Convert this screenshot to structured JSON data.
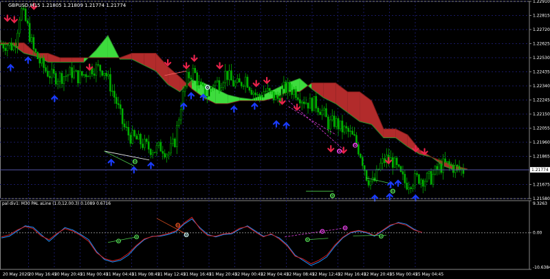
{
  "window": {
    "main_title": "GBPUSD,M15  1.21805 1.21809 1.21774 1.21774",
    "indicator_title": "pal div1: M30 PAL aLine (1.0,12.00.3) 0.1089 0.6716"
  },
  "chart_data": [
    {
      "type": "candlestick",
      "symbol": "GBPUSD",
      "timeframe": "M15",
      "ohlc_header": {
        "open": 1.21805,
        "high": 1.21809,
        "low": 1.21774,
        "close": 1.21774
      },
      "ylim": [
        1.2158,
        1.2291
      ],
      "y_ticks": [
        "1.22910",
        "1.22815",
        "1.22720",
        "1.22625",
        "1.22530",
        "1.22435",
        "1.22340",
        "1.22245",
        "1.22150",
        "1.22055",
        "1.21960",
        "1.21865",
        "1.21675",
        "1.21580"
      ],
      "current_price_label": "1.21774",
      "current_price": 1.21774,
      "close_path": [
        1.2262,
        1.2262,
        1.226,
        1.2286,
        1.2275,
        1.2258,
        1.225,
        1.2244,
        1.224,
        1.224,
        1.2241,
        1.2243,
        1.224,
        1.2242,
        1.2246,
        1.2246,
        1.2245,
        1.2234,
        1.2222,
        1.2207,
        1.22,
        1.2198,
        1.2195,
        1.2192,
        1.2191,
        1.2193,
        1.2188,
        1.2196,
        1.2222,
        1.224,
        1.2244,
        1.2232,
        1.2228,
        1.2236,
        1.2236,
        1.2243,
        1.2236,
        1.2234,
        1.224,
        1.2232,
        1.2226,
        1.2231,
        1.2228,
        1.2225,
        1.2232,
        1.2232,
        1.223,
        1.2225,
        1.2222,
        1.2222,
        1.2217,
        1.2208,
        1.221,
        1.2205,
        1.2203,
        1.2198,
        1.2188,
        1.2172,
        1.2168,
        1.218,
        1.2185,
        1.2183,
        1.2175,
        1.2168,
        1.217,
        1.2172,
        1.2171,
        1.2172,
        1.2178,
        1.2181,
        1.218,
        1.2178,
        1.2177
      ],
      "cloud": {
        "span_a": [
          1.2262,
          1.2262,
          1.2256,
          1.2254,
          1.225,
          1.225,
          1.225,
          1.225,
          1.2258,
          1.2268,
          1.2252,
          1.2252,
          1.2248,
          1.2244,
          1.2235,
          1.223,
          1.2238,
          1.2236,
          1.2232,
          1.2228,
          1.2226,
          1.2225,
          1.2228,
          1.2232,
          1.2236,
          1.2239,
          1.2232,
          1.2226,
          1.2222,
          1.2216,
          1.221,
          1.2208,
          1.2199,
          1.2199,
          1.2193,
          1.2188,
          1.2186,
          1.218,
          1.2177,
          1.2178
        ],
        "span_b": [
          1.2263,
          1.2263,
          1.2263,
          1.2256,
          1.2256,
          1.2253,
          1.2253,
          1.2253,
          1.2253,
          1.2253,
          1.2253,
          1.2256,
          1.2256,
          1.2256,
          1.2247,
          1.224,
          1.2232,
          1.2226,
          1.2222,
          1.2222,
          1.2224,
          1.2224,
          1.2224,
          1.2226,
          1.223,
          1.223,
          1.2236,
          1.2236,
          1.2236,
          1.223,
          1.223,
          1.2224,
          1.2205,
          1.2205,
          1.2201,
          1.2191,
          1.2186,
          1.2183,
          1.218,
          1.2178
        ],
        "bull_color": "#3ddc3d",
        "bear_color": "#b22b2b"
      },
      "series_colors": {
        "candles": "#00b000",
        "grid": "#1a1a66",
        "sell_arrow": "#e8234a",
        "buy_arrow": "#1a3cff"
      },
      "annotations": [
        {
          "type": "sell_arrow",
          "t": 0.014,
          "price": 1.2276
        },
        {
          "type": "sell_arrow",
          "t": 0.027,
          "price": 1.2275
        },
        {
          "type": "sell_arrow",
          "t": 0.064,
          "price": 1.2284
        },
        {
          "type": "sell_arrow",
          "t": 0.169,
          "price": 1.2243
        },
        {
          "type": "sell_arrow",
          "t": 0.317,
          "price": 1.2246
        },
        {
          "type": "sell_arrow",
          "t": 0.352,
          "price": 1.2244
        },
        {
          "type": "sell_arrow",
          "t": 0.367,
          "price": 1.2249
        },
        {
          "type": "sell_arrow",
          "t": 0.415,
          "price": 1.2244
        },
        {
          "type": "sell_arrow",
          "t": 0.484,
          "price": 1.2232
        },
        {
          "type": "sell_arrow",
          "t": 0.504,
          "price": 1.2234
        },
        {
          "type": "sell_arrow",
          "t": 0.533,
          "price": 1.222
        },
        {
          "type": "sell_arrow",
          "t": 0.561,
          "price": 1.2216
        },
        {
          "type": "sell_arrow",
          "t": 0.625,
          "price": 1.2188
        },
        {
          "type": "sell_arrow",
          "t": 0.649,
          "price": 1.2187
        },
        {
          "type": "sell_arrow",
          "t": 0.734,
          "price": 1.218
        },
        {
          "type": "sell_arrow",
          "t": 0.785,
          "price": 1.2188
        },
        {
          "type": "sell_arrow",
          "t": 0.802,
          "price": 1.2186
        },
        {
          "type": "buy_arrow",
          "t": 0.02,
          "price": 1.225
        },
        {
          "type": "buy_arrow",
          "t": 0.053,
          "price": 1.2255
        },
        {
          "type": "buy_arrow",
          "t": 0.103,
          "price": 1.2229
        },
        {
          "type": "buy_arrow",
          "t": 0.21,
          "price": 1.2186
        },
        {
          "type": "buy_arrow",
          "t": 0.253,
          "price": 1.2181
        },
        {
          "type": "buy_arrow",
          "t": 0.285,
          "price": 1.2184
        },
        {
          "type": "buy_arrow",
          "t": 0.347,
          "price": 1.2224
        },
        {
          "type": "buy_arrow",
          "t": 0.361,
          "price": 1.2231
        },
        {
          "type": "buy_arrow",
          "t": 0.384,
          "price": 1.223
        },
        {
          "type": "buy_arrow",
          "t": 0.442,
          "price": 1.2222
        },
        {
          "type": "buy_arrow",
          "t": 0.481,
          "price": 1.2224
        },
        {
          "type": "buy_arrow",
          "t": 0.522,
          "price": 1.2212
        },
        {
          "type": "buy_arrow",
          "t": 0.541,
          "price": 1.2211
        },
        {
          "type": "buy_arrow",
          "t": 0.708,
          "price": 1.2162
        },
        {
          "type": "buy_arrow",
          "t": 0.736,
          "price": 1.2163
        },
        {
          "type": "buy_arrow",
          "t": 0.785,
          "price": 1.2162
        },
        {
          "type": "buy_arrow",
          "t": 0.752,
          "price": 1.2172
        },
        {
          "type": "buy_arrow",
          "t": 0.738,
          "price": 1.2171
        }
      ],
      "divergence_markers": [
        {
          "label": "0",
          "t": 0.255,
          "price": 1.2183,
          "color": "#4fd04f"
        },
        {
          "label": "0",
          "t": 0.392,
          "price": 1.2233,
          "color": "#c8f0f0"
        },
        {
          "label": "0",
          "t": 0.641,
          "price": 1.219,
          "color": "#e040e0"
        },
        {
          "label": "0",
          "t": 0.671,
          "price": 1.2194,
          "color": "#e040e0"
        },
        {
          "label": "0",
          "t": 0.628,
          "price": 1.216,
          "color": "#4fd04f"
        },
        {
          "label": "0",
          "t": 0.742,
          "price": 1.2163,
          "color": "#4fd04f"
        }
      ]
    },
    {
      "type": "line",
      "title": "pal div1: M30 PAL aLine (1.0,12.00.3) 0.1089 0.6716",
      "ylim": [
        -10.6384,
        9.3263
      ],
      "y_ticks": [
        "9.3263",
        "0.00",
        "-10.6384"
      ],
      "series": [
        {
          "name": "",
          "color": "#1e90ff",
          "values": [
            -1.5,
            -1.0,
            0.5,
            2.0,
            1.6,
            -0.5,
            -2.5,
            -0.5,
            1.5,
            0.8,
            -0.5,
            -2.0,
            -5.5,
            -7.8,
            -8.5,
            -8.0,
            -6.5,
            -4.0,
            -2.0,
            -1.0,
            -1.0,
            -0.5,
            0.3,
            2.5,
            4.0,
            1.5,
            -0.5,
            -1.2,
            -0.5,
            -0.3,
            1.0,
            2.0,
            0.5,
            -1.0,
            -0.5,
            -1.5,
            -3.5,
            -6.5,
            -8.0,
            -9.5,
            -8.5,
            -7.0,
            -4.0,
            -1.5,
            0.0,
            0.5,
            0.0,
            -1.0,
            0.5,
            2.0,
            3.0,
            2.5,
            1.0,
            0.0
          ]
        },
        {
          "name": "",
          "color": "#d62020",
          "values": [
            -1.2,
            -0.6,
            0.8,
            1.8,
            1.2,
            -0.9,
            -2.0,
            -0.2,
            1.2,
            0.5,
            -0.8,
            -2.5,
            -5.8,
            -7.5,
            -8.2,
            -7.6,
            -6.0,
            -3.7,
            -1.8,
            -1.1,
            -0.8,
            -0.2,
            0.6,
            2.8,
            4.5,
            1.2,
            -0.8,
            -1.0,
            -0.3,
            -0.1,
            1.3,
            1.8,
            0.2,
            -1.2,
            -0.3,
            -1.8,
            -3.8,
            -6.8,
            -7.6,
            -9.0,
            -8.0,
            -6.5,
            -3.6,
            -1.3,
            0.2,
            0.7,
            0.2,
            -0.8,
            0.7,
            2.3,
            2.8,
            2.2,
            0.8,
            0.1
          ]
        }
      ],
      "divergence_markers": [
        {
          "label": "0",
          "t": 0.224,
          "value": -2.4,
          "color": "#4fd04f"
        },
        {
          "label": "0",
          "t": 0.258,
          "value": -1.2,
          "color": "#4fd04f"
        },
        {
          "label": "0",
          "t": 0.336,
          "value": 2.2,
          "color": "#e05020"
        },
        {
          "label": "0",
          "t": 0.352,
          "value": -0.6,
          "color": "#c8f0f0"
        },
        {
          "label": "0",
          "t": 0.581,
          "value": -2.0,
          "color": "#4fd04f"
        },
        {
          "label": "0",
          "t": 0.609,
          "value": 0.4,
          "color": "#e040e0"
        },
        {
          "label": "0",
          "t": 0.652,
          "value": 1.4,
          "color": "#e040e0"
        },
        {
          "label": "0",
          "t": 0.72,
          "value": -1.0,
          "color": "#4fd04f"
        }
      ]
    }
  ],
  "x_axis": {
    "labels": [
      "20 May 2020",
      "20 May 16:45",
      "20 May 20:45",
      "21 May 00:45",
      "21 May 04:45",
      "21 May 08:45",
      "21 May 12:45",
      "21 May 16:45",
      "21 May 20:45",
      "22 May 00:45",
      "22 May 04:45",
      "22 May 08:45",
      "22 May 12:45",
      "22 May 16:45",
      "22 May 20:45",
      "25 May 00:45",
      "25 May 04:45"
    ]
  }
}
